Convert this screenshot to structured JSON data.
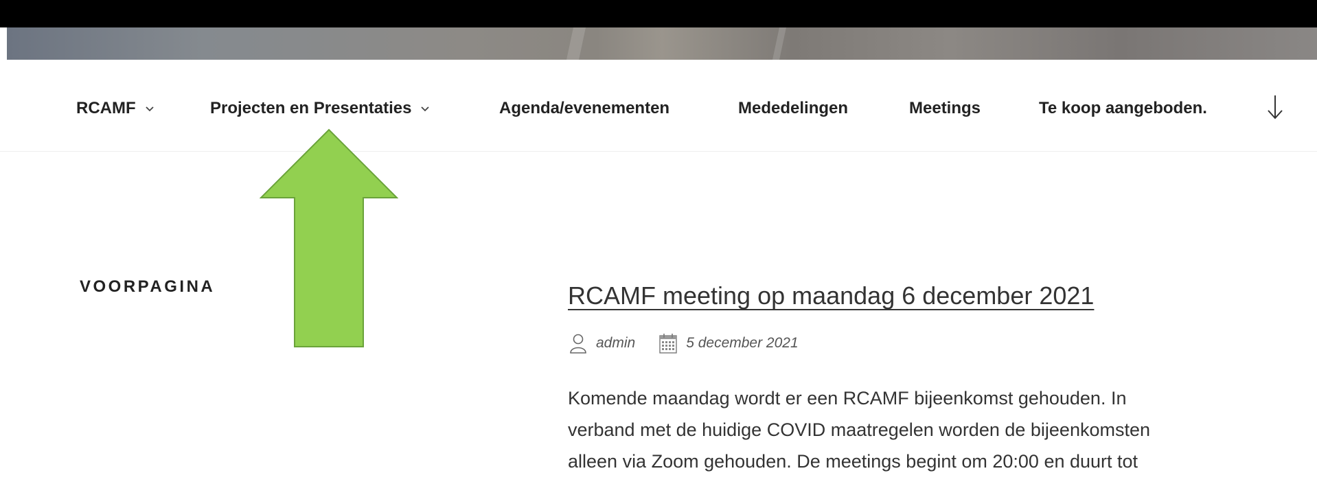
{
  "nav": {
    "items": [
      {
        "label": "RCAMF",
        "has_dropdown": true
      },
      {
        "label": "Projecten en Presentaties",
        "has_dropdown": true
      },
      {
        "label": "Agenda/evenementen",
        "has_dropdown": false
      },
      {
        "label": "Mededelingen",
        "has_dropdown": false
      },
      {
        "label": "Meetings",
        "has_dropdown": false
      },
      {
        "label": "Te koop aangeboden.",
        "has_dropdown": false
      }
    ],
    "scroll_icon": "arrow-down-icon"
  },
  "sidebar": {
    "title": "Voorpagina"
  },
  "annotation": {
    "icon": "green-up-arrow",
    "color": "#92d050"
  },
  "post": {
    "title": "RCAMF meeting op maandag 6 december 2021",
    "author": "admin",
    "date": "5 december 2021",
    "body_lines": [
      "Komende maandag wordt er een RCAMF bijeenkomst gehouden. In",
      "verband met de huidige COVID maatregelen worden de bijeenkomsten",
      "alleen via Zoom gehouden. De meetings begint om 20:00 en duurt tot"
    ]
  }
}
